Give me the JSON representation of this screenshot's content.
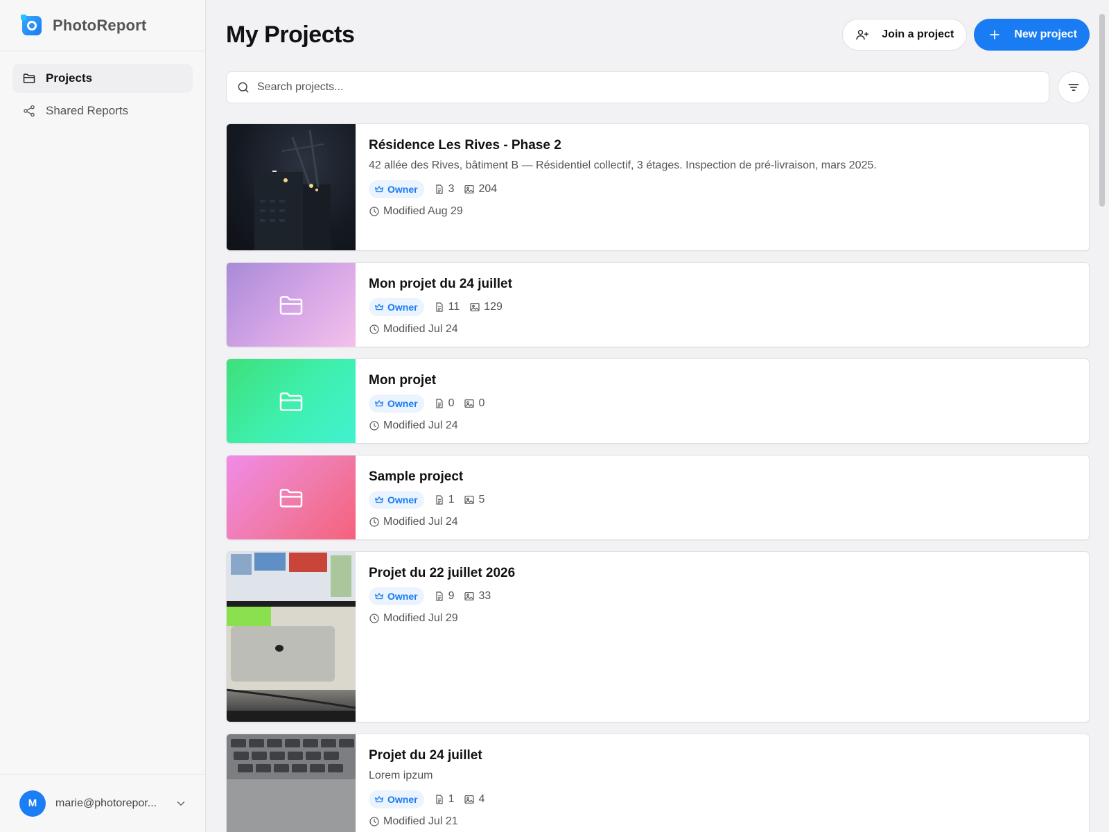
{
  "app": {
    "name": "PhotoReport"
  },
  "sidebar": {
    "items": [
      {
        "label": "Projects",
        "icon": "folder-icon",
        "active": true
      },
      {
        "label": "Shared Reports",
        "icon": "share-icon",
        "active": false
      }
    ],
    "user": {
      "initial": "M",
      "email": "marie@photorepor..."
    }
  },
  "header": {
    "title": "My Projects",
    "join_label": "Join a project",
    "new_label": "New project"
  },
  "search": {
    "placeholder": "Search projects..."
  },
  "colors": {
    "accent": "#1a7cf2",
    "owner_bg": "#eaf3fe"
  },
  "projects": [
    {
      "title": "Résidence Les Rives - Phase 2",
      "description": "42 allée des Rives, bâtiment B — Résidentiel collectif, 3 étages. Inspection de pré-livraison, mars 2025.",
      "role": "Owner",
      "reports": "3",
      "photos": "204",
      "modified": "Modified Aug 29",
      "thumb": "photo-construction"
    },
    {
      "title": "Mon projet du 24 juillet",
      "description": "",
      "role": "Owner",
      "reports": "11",
      "photos": "129",
      "modified": "Modified Jul 24",
      "thumb": "folder-purple"
    },
    {
      "title": "Mon projet",
      "description": "",
      "role": "Owner",
      "reports": "0",
      "photos": "0",
      "modified": "Modified Jul 24",
      "thumb": "folder-green"
    },
    {
      "title": "Sample project",
      "description": "",
      "role": "Owner",
      "reports": "1",
      "photos": "5",
      "modified": "Modified Jul 24",
      "thumb": "folder-pink"
    },
    {
      "title": "Projet du 22 juillet 2026",
      "description": "",
      "role": "Owner",
      "reports": "9",
      "photos": "33",
      "modified": "Modified Jul 29",
      "thumb": "photo-desk"
    },
    {
      "title": "Projet du 24 juillet",
      "description": "Lorem ipzum",
      "role": "Owner",
      "reports": "1",
      "photos": "4",
      "modified": "Modified Jul 21",
      "thumb": "photo-keyboard"
    }
  ]
}
